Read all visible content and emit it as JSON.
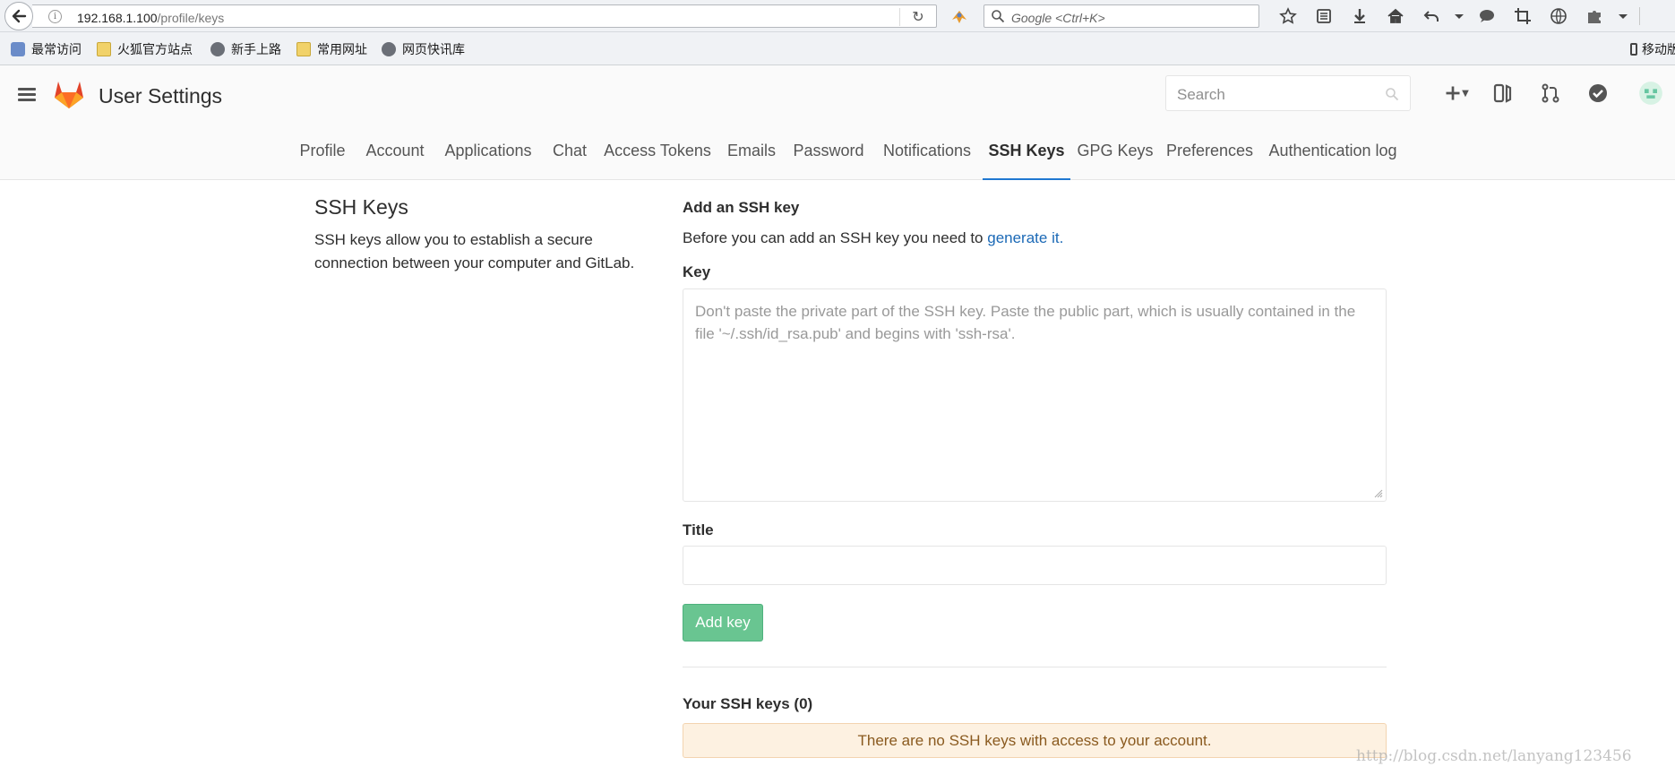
{
  "browser": {
    "url_host": "192.168.1.100",
    "url_path": "/profile/keys",
    "search_placeholder": "Google <Ctrl+K>",
    "toolbar_icons": [
      "bookmark-star-icon",
      "reading-list-icon",
      "download-icon",
      "home-icon",
      "undo-icon",
      "dropdown-icon",
      "chat-icon",
      "crop-icon",
      "globe-icon",
      "puzzle-icon",
      "menu-icon"
    ]
  },
  "bookmarks": [
    {
      "label": "最常访问",
      "icon": "most-visited-icon"
    },
    {
      "label": "火狐官方站点",
      "icon": "folder-icon"
    },
    {
      "label": "新手上路",
      "icon": "globe-icon"
    },
    {
      "label": "常用网址",
      "icon": "folder-icon"
    },
    {
      "label": "网页快讯库",
      "icon": "globe-icon"
    },
    {
      "label": "移动版",
      "icon": "mobile-icon"
    }
  ],
  "header": {
    "title": "User Settings",
    "search_placeholder": "Search"
  },
  "tabs": [
    {
      "label": "Profile"
    },
    {
      "label": "Account"
    },
    {
      "label": "Applications"
    },
    {
      "label": "Chat"
    },
    {
      "label": "Access Tokens"
    },
    {
      "label": "Emails"
    },
    {
      "label": "Password"
    },
    {
      "label": "Notifications"
    },
    {
      "label": "SSH Keys",
      "active": true
    },
    {
      "label": "GPG Keys"
    },
    {
      "label": "Preferences"
    },
    {
      "label": "Authentication log"
    }
  ],
  "left": {
    "title": "SSH Keys",
    "description": "SSH keys allow you to establish a secure connection between your computer and GitLab."
  },
  "form": {
    "heading": "Add an SSH key",
    "help_text": "Before you can add an SSH key you need to ",
    "help_link": "generate it.",
    "key_label": "Key",
    "key_placeholder": "Don't paste the private part of the SSH key. Paste the public part, which is usually contained in the file '~/.ssh/id_rsa.pub' and begins with 'ssh-rsa'.",
    "title_label": "Title",
    "title_value": "",
    "submit_label": "Add key"
  },
  "keys": {
    "heading": "Your SSH keys (0)",
    "empty_message": "There are no SSH keys with access to your account."
  },
  "watermark": "http://blog.csdn.net/lanyang123456",
  "colors": {
    "accent": "#1f78d1",
    "success_button": "#69c591",
    "warning_bg": "#fdf1e1",
    "link": "#1b69b6"
  }
}
